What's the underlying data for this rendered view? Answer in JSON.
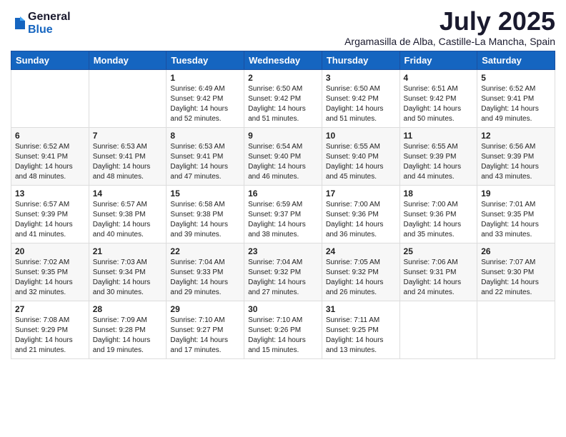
{
  "header": {
    "logo": {
      "general": "General",
      "blue": "Blue"
    },
    "month": "July 2025",
    "location": "Argamasilla de Alba, Castille-La Mancha, Spain"
  },
  "weekdays": [
    "Sunday",
    "Monday",
    "Tuesday",
    "Wednesday",
    "Thursday",
    "Friday",
    "Saturday"
  ],
  "weeks": [
    [
      {
        "day": "",
        "content": ""
      },
      {
        "day": "",
        "content": ""
      },
      {
        "day": "1",
        "content": "Sunrise: 6:49 AM\nSunset: 9:42 PM\nDaylight: 14 hours and 52 minutes."
      },
      {
        "day": "2",
        "content": "Sunrise: 6:50 AM\nSunset: 9:42 PM\nDaylight: 14 hours and 51 minutes."
      },
      {
        "day": "3",
        "content": "Sunrise: 6:50 AM\nSunset: 9:42 PM\nDaylight: 14 hours and 51 minutes."
      },
      {
        "day": "4",
        "content": "Sunrise: 6:51 AM\nSunset: 9:42 PM\nDaylight: 14 hours and 50 minutes."
      },
      {
        "day": "5",
        "content": "Sunrise: 6:52 AM\nSunset: 9:41 PM\nDaylight: 14 hours and 49 minutes."
      }
    ],
    [
      {
        "day": "6",
        "content": "Sunrise: 6:52 AM\nSunset: 9:41 PM\nDaylight: 14 hours and 48 minutes."
      },
      {
        "day": "7",
        "content": "Sunrise: 6:53 AM\nSunset: 9:41 PM\nDaylight: 14 hours and 48 minutes."
      },
      {
        "day": "8",
        "content": "Sunrise: 6:53 AM\nSunset: 9:41 PM\nDaylight: 14 hours and 47 minutes."
      },
      {
        "day": "9",
        "content": "Sunrise: 6:54 AM\nSunset: 9:40 PM\nDaylight: 14 hours and 46 minutes."
      },
      {
        "day": "10",
        "content": "Sunrise: 6:55 AM\nSunset: 9:40 PM\nDaylight: 14 hours and 45 minutes."
      },
      {
        "day": "11",
        "content": "Sunrise: 6:55 AM\nSunset: 9:39 PM\nDaylight: 14 hours and 44 minutes."
      },
      {
        "day": "12",
        "content": "Sunrise: 6:56 AM\nSunset: 9:39 PM\nDaylight: 14 hours and 43 minutes."
      }
    ],
    [
      {
        "day": "13",
        "content": "Sunrise: 6:57 AM\nSunset: 9:39 PM\nDaylight: 14 hours and 41 minutes."
      },
      {
        "day": "14",
        "content": "Sunrise: 6:57 AM\nSunset: 9:38 PM\nDaylight: 14 hours and 40 minutes."
      },
      {
        "day": "15",
        "content": "Sunrise: 6:58 AM\nSunset: 9:38 PM\nDaylight: 14 hours and 39 minutes."
      },
      {
        "day": "16",
        "content": "Sunrise: 6:59 AM\nSunset: 9:37 PM\nDaylight: 14 hours and 38 minutes."
      },
      {
        "day": "17",
        "content": "Sunrise: 7:00 AM\nSunset: 9:36 PM\nDaylight: 14 hours and 36 minutes."
      },
      {
        "day": "18",
        "content": "Sunrise: 7:00 AM\nSunset: 9:36 PM\nDaylight: 14 hours and 35 minutes."
      },
      {
        "day": "19",
        "content": "Sunrise: 7:01 AM\nSunset: 9:35 PM\nDaylight: 14 hours and 33 minutes."
      }
    ],
    [
      {
        "day": "20",
        "content": "Sunrise: 7:02 AM\nSunset: 9:35 PM\nDaylight: 14 hours and 32 minutes."
      },
      {
        "day": "21",
        "content": "Sunrise: 7:03 AM\nSunset: 9:34 PM\nDaylight: 14 hours and 30 minutes."
      },
      {
        "day": "22",
        "content": "Sunrise: 7:04 AM\nSunset: 9:33 PM\nDaylight: 14 hours and 29 minutes."
      },
      {
        "day": "23",
        "content": "Sunrise: 7:04 AM\nSunset: 9:32 PM\nDaylight: 14 hours and 27 minutes."
      },
      {
        "day": "24",
        "content": "Sunrise: 7:05 AM\nSunset: 9:32 PM\nDaylight: 14 hours and 26 minutes."
      },
      {
        "day": "25",
        "content": "Sunrise: 7:06 AM\nSunset: 9:31 PM\nDaylight: 14 hours and 24 minutes."
      },
      {
        "day": "26",
        "content": "Sunrise: 7:07 AM\nSunset: 9:30 PM\nDaylight: 14 hours and 22 minutes."
      }
    ],
    [
      {
        "day": "27",
        "content": "Sunrise: 7:08 AM\nSunset: 9:29 PM\nDaylight: 14 hours and 21 minutes."
      },
      {
        "day": "28",
        "content": "Sunrise: 7:09 AM\nSunset: 9:28 PM\nDaylight: 14 hours and 19 minutes."
      },
      {
        "day": "29",
        "content": "Sunrise: 7:10 AM\nSunset: 9:27 PM\nDaylight: 14 hours and 17 minutes."
      },
      {
        "day": "30",
        "content": "Sunrise: 7:10 AM\nSunset: 9:26 PM\nDaylight: 14 hours and 15 minutes."
      },
      {
        "day": "31",
        "content": "Sunrise: 7:11 AM\nSunset: 9:25 PM\nDaylight: 14 hours and 13 minutes."
      },
      {
        "day": "",
        "content": ""
      },
      {
        "day": "",
        "content": ""
      }
    ]
  ]
}
